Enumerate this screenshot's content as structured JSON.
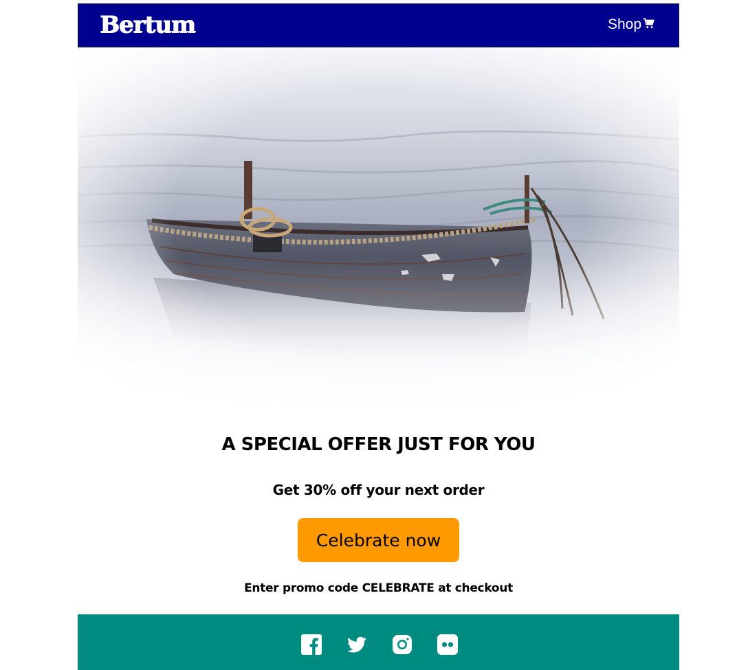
{
  "header": {
    "brand": "Bertum",
    "shop_label": "Shop",
    "cart_icon": "shopping-cart-icon",
    "background": "#000090"
  },
  "hero": {
    "image": "rowboat-on-misty-water"
  },
  "offer": {
    "headline": "A SPECIAL OFFER JUST FOR YOU",
    "subheadline": "Get 30% off your next order",
    "cta_label": "Celebrate now",
    "cta_color": "#ff9900",
    "promo_text": "Enter promo code CELEBRATE at checkout"
  },
  "footer": {
    "background": "#008b80",
    "social_icons": [
      "facebook-icon",
      "twitter-icon",
      "instagram-icon",
      "flickr-icon"
    ]
  }
}
